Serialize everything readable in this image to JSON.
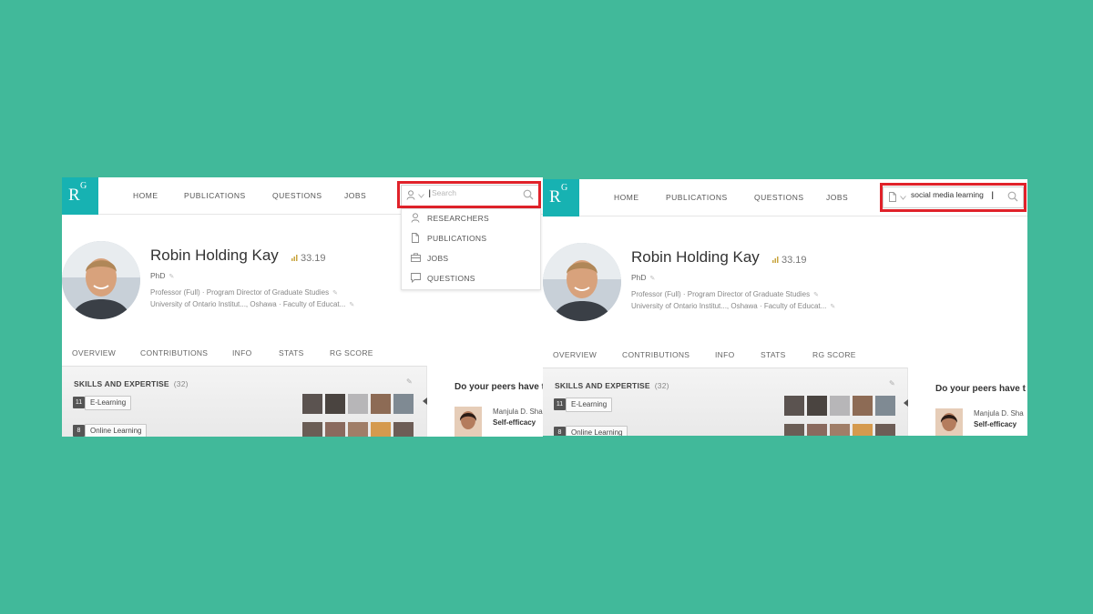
{
  "colors": {
    "background": "#41b99a",
    "logo": "#17b2b2",
    "highlight": "#e0222a"
  },
  "logo": {
    "r": "R",
    "g": "G"
  },
  "nav": {
    "home": "HOME",
    "publications": "PUBLICATIONS",
    "questions": "QUESTIONS",
    "jobs": "JOBS"
  },
  "left": {
    "search": {
      "placeholder": "Search",
      "value": "",
      "type_icon": "person-icon"
    },
    "dropdown": [
      {
        "label": "RESEARCHERS",
        "icon": "person-icon"
      },
      {
        "label": "PUBLICATIONS",
        "icon": "document-icon"
      },
      {
        "label": "JOBS",
        "icon": "briefcase-icon"
      },
      {
        "label": "QUESTIONS",
        "icon": "speech-bubble-icon"
      }
    ]
  },
  "right": {
    "search": {
      "placeholder": "",
      "value": "social media learning",
      "type_icon": "document-icon"
    }
  },
  "profile": {
    "name": "Robin Holding Kay",
    "rg_score": "33.19",
    "degree": "PhD",
    "position": "Professor (Full) · Program Director of Graduate Studies",
    "institution": "University of Ontario Institut..., Oshawa · Faculty of Educat..."
  },
  "tabs": [
    "OVERVIEW",
    "CONTRIBUTIONS",
    "INFO",
    "STATS",
    "RG SCORE"
  ],
  "skills": {
    "title": "SKILLS AND EXPERTISE",
    "count": "(32)",
    "items": [
      {
        "count": "11",
        "label": "E-Learning"
      },
      {
        "count": "8",
        "label": "Online Learning"
      }
    ]
  },
  "sidebar": {
    "peers_title": "Do your peers have t",
    "peer_name": "Manjula D. Sha",
    "peer_skill": "Self-efficacy"
  }
}
